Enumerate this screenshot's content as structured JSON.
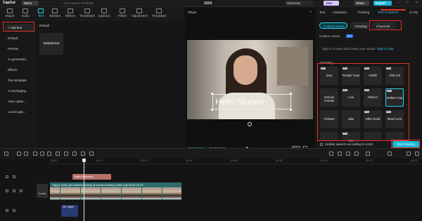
{
  "titlebar": {
    "app_name": "CapCut",
    "menu_label": "Menu",
    "autosaved": "Auto saved: 04:25:58",
    "project_name": "1024",
    "shortcuts_label": "Shortcuts",
    "joinpro_label": "Join Pro",
    "share_label": "Share",
    "export_label": "Export"
  },
  "tool_tabs": [
    {
      "label": "Import",
      "active": false
    },
    {
      "label": "Audio",
      "active": false
    },
    {
      "label": "Text",
      "active": true
    },
    {
      "label": "Stickers",
      "active": false
    },
    {
      "label": "Effects",
      "active": false
    },
    {
      "label": "Transitions",
      "active": false
    },
    {
      "label": "Captions",
      "active": false
    },
    {
      "label": "Filters",
      "active": false
    },
    {
      "label": "Adjustment",
      "active": false
    },
    {
      "label": "Templates",
      "active": false
    }
  ],
  "sidebar": {
    "items": [
      {
        "label": "+ Add text"
      },
      {
        "label": "Default"
      },
      {
        "label": "Presets"
      },
      {
        "label": "AI generated"
      },
      {
        "label": "Effects"
      },
      {
        "label": "Text template"
      },
      {
        "label": "AI packaging"
      },
      {
        "label": "Auto captio..."
      },
      {
        "label": "Local capti..."
      }
    ]
  },
  "template_panel": {
    "section_label": "Default",
    "card_label": "Default text"
  },
  "player": {
    "title": "Player",
    "caption_text": "Hello Studen",
    "timecode_current": "00:00:07:25",
    "timecode_total": "00:00:29:26",
    "ratio_label": "Ratio"
  },
  "right_panel": {
    "tabs": [
      {
        "label": "Text",
        "active": false
      },
      {
        "label": "Animation",
        "active": false
      },
      {
        "label": "Tracking",
        "active": false
      },
      {
        "label": "Text-to-speech",
        "active": true
      },
      {
        "label": "AI Sty",
        "active": false
      }
    ],
    "filter_pills": [
      {
        "label": "Custom voices",
        "active": true
      },
      {
        "label": "Trending",
        "active": false
      },
      {
        "label": "Character",
        "active": false
      }
    ],
    "custom_voices_label": "Custom voices",
    "new_badge": "New",
    "signin_text": "Sign in to view and create your voices.",
    "signin_link": "Sign in now",
    "trending_label": "Trending",
    "voices": [
      {
        "name": "Sara",
        "pro": true,
        "selected": false
      },
      {
        "name": "Female Tutor",
        "pro": true,
        "selected": false
      },
      {
        "name": "ASMR",
        "pro": true,
        "selected": false
      },
      {
        "name": "Chill Girl",
        "pro": true,
        "selected": false
      },
      {
        "name": "Serious Female",
        "pro": false,
        "selected": false
      },
      {
        "name": "Lois",
        "pro": true,
        "selected": false
      },
      {
        "name": "Gloria II",
        "pro": true,
        "selected": false
      },
      {
        "name": "Stalker Crop",
        "pro": true,
        "selected": true
      },
      {
        "name": "Trickster",
        "pro": false,
        "selected": false
      },
      {
        "name": "Julie",
        "pro": false,
        "selected": false
      },
      {
        "name": "Killer Droid",
        "pro": true,
        "selected": false
      },
      {
        "name": "Blood Lord",
        "pro": true,
        "selected": false
      },
      {
        "name": "",
        "pro": false,
        "selected": false
      },
      {
        "name": "Vex",
        "pro": true,
        "selected": false
      },
      {
        "name": "",
        "pro": false,
        "selected": false
      },
      {
        "name": "",
        "pro": false,
        "selected": false
      }
    ],
    "update_label": "Update speech according to script",
    "start_reading_label": "Start reading"
  },
  "timeline": {
    "ruler_ticks": [
      "00:00",
      "|00:10",
      "|00:20",
      "|00:30",
      "|00:40",
      "|00:50",
      "|01:00",
      "|01:10",
      "|01:20"
    ],
    "text_clip_label": "Hello Students",
    "video_clip_label": "Happy asian girl student looking at camera making video call  00:00:29:26",
    "cover_label": "Cover",
    "audio_clip_label": "Hi! I Might"
  },
  "colors": {
    "accent": "#2ed3f0",
    "annotation_red": "#e0322a",
    "export_bg": "#19b6d9",
    "text_clip": "#b7716a",
    "video_clip": "#2d6a6c",
    "audio_clip": "#2a3a72"
  }
}
